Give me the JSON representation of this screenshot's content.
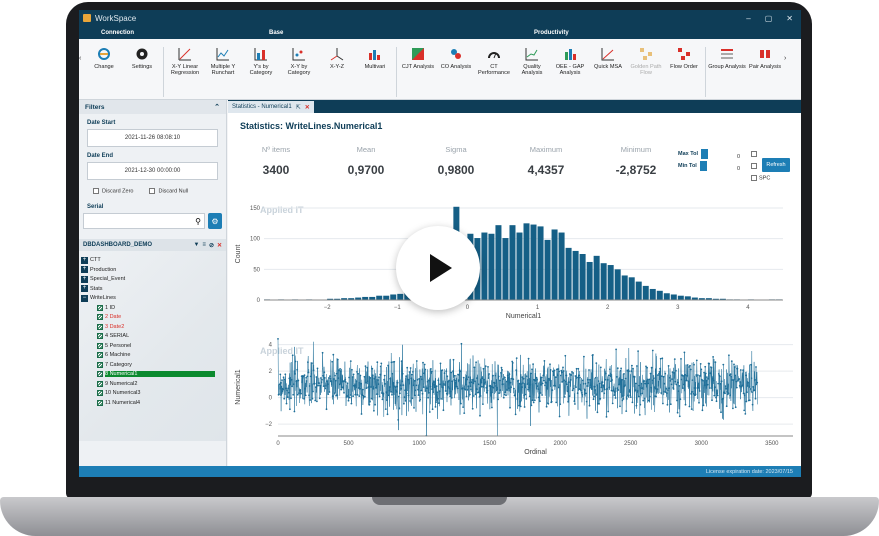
{
  "window": {
    "title": "WorkSpace",
    "controls": [
      "–",
      "▢",
      "✕"
    ]
  },
  "ribbon": {
    "groups": [
      "Connection",
      "Base",
      "Productivity"
    ],
    "buttons": [
      {
        "label": "Change",
        "icon": "connection-change-icon"
      },
      {
        "label": "Settings",
        "icon": "gear-icon"
      },
      {
        "label": "X-Y Linear Regression",
        "icon": "regression-icon"
      },
      {
        "label": "Multiple Y Runchart",
        "icon": "runchart-icon"
      },
      {
        "label": "Y's by Category",
        "icon": "category-icon"
      },
      {
        "label": "X-Y by Category",
        "icon": "xy-category-icon"
      },
      {
        "label": "X-Y-Z",
        "icon": "xyz-icon"
      },
      {
        "label": "Multivari",
        "icon": "multivari-icon"
      },
      {
        "label": "CJT Analysis",
        "icon": "cjt-icon"
      },
      {
        "label": "CO Analysis",
        "icon": "co-icon"
      },
      {
        "label": "CT Performance",
        "icon": "gauge-icon"
      },
      {
        "label": "Quality Analysis",
        "icon": "quality-icon"
      },
      {
        "label": "OEE - GAP Analysis",
        "icon": "oee-icon"
      },
      {
        "label": "Quick MSA",
        "icon": "msa-icon"
      },
      {
        "label": "Golden Path Flow",
        "icon": "golden-path-icon"
      },
      {
        "label": "Flow Order",
        "icon": "flow-order-icon"
      },
      {
        "label": "Group Analysis",
        "icon": "group-icon"
      },
      {
        "label": "Pair Analysis",
        "icon": "pair-icon"
      }
    ]
  },
  "filters": {
    "title": "Filters",
    "date_start_label": "Date Start",
    "date_start": "2021-11-26 08:08:10",
    "date_end_label": "Date End",
    "date_end": "2021-12-30 00:00:00",
    "discard_zero": "Discard Zero",
    "discard_null": "Discard Null",
    "serial_label": "Serial"
  },
  "database": {
    "name": "DBDASHBOARD_DEMO",
    "tables": [
      "CTT",
      "Production",
      "Special_Event",
      "Stats",
      "WriteLines"
    ],
    "fields": [
      "1 ID",
      "2 Date",
      "3 Date2",
      "4 SERIAL",
      "5 Personel",
      "6 Machine",
      "7 Category",
      "8 Numerical1",
      "9 Numerical2",
      "10 Numerical3",
      "11 Numerical4"
    ]
  },
  "doc_tab": "Statistics - Numerical1",
  "statistics": {
    "title": "Statistics: WriteLines.Numerical1",
    "items": [
      {
        "label": "Nº items",
        "value": "3400"
      },
      {
        "label": "Mean",
        "value": "0,9700"
      },
      {
        "label": "Sigma",
        "value": "0,9800"
      },
      {
        "label": "Maximum",
        "value": "4,4357"
      },
      {
        "label": "Minimum",
        "value": "-2,8752"
      }
    ],
    "max_tol_label": "Max Tol",
    "min_tol_label": "Min Tol",
    "max_tol_value": "0",
    "min_tol_value": "0",
    "spc_label": "SPC",
    "refresh_label": "Refresh"
  },
  "watermark": "Applied IT",
  "status": "License expiration date: 2023/07/15",
  "colors": {
    "accent": "#1d7eb5",
    "bar": "#155f86",
    "title": "#0e3d57"
  },
  "chart_data": [
    {
      "type": "bar",
      "xlabel": "Numerical1",
      "ylabel": "Count",
      "xlim": [
        -2.9,
        4.5
      ],
      "ylim": [
        0,
        150
      ],
      "xticks": [
        -2,
        -1,
        0,
        1,
        2,
        3,
        4
      ],
      "yticks": [
        0,
        50,
        100,
        150
      ],
      "bin_start": -2.9,
      "bin_width": 0.1,
      "values": [
        1,
        0,
        1,
        0,
        1,
        0,
        1,
        0,
        0,
        2,
        2,
        3,
        3,
        4,
        5,
        5,
        7,
        7,
        9,
        10,
        12,
        13,
        17,
        22,
        26,
        20,
        40,
        152,
        98,
        108,
        101,
        110,
        108,
        122,
        101,
        122,
        110,
        125,
        123,
        120,
        98,
        115,
        110,
        85,
        80,
        75,
        62,
        72,
        60,
        57,
        50,
        40,
        37,
        30,
        23,
        18,
        15,
        11,
        9,
        7,
        6,
        4,
        3,
        3,
        2,
        2,
        1,
        1,
        0,
        1,
        0,
        0,
        1,
        1
      ]
    },
    {
      "type": "scatter",
      "xlabel": "Ordinal",
      "ylabel": "Numerical1",
      "xlim": [
        0,
        3400
      ],
      "ylim": [
        -2.9,
        4.5
      ],
      "xticks": [
        0,
        500,
        1000,
        1500,
        2000,
        2500,
        3000,
        3500
      ],
      "yticks": [
        -2,
        0,
        2,
        4
      ],
      "n_points": 3400,
      "mean": 0.97,
      "sigma": 0.98,
      "min": -2.8752,
      "max": 4.4357
    }
  ]
}
